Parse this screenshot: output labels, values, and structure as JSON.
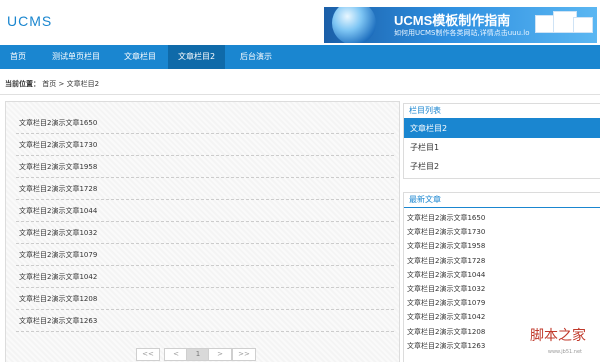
{
  "header": {
    "logo": "UCMS",
    "banner_title": "UCMS模板制作指南",
    "banner_subtitle": "如何用UCMS制作各类网站,详情点击uuu.lo"
  },
  "nav": {
    "items": [
      {
        "label": "首页"
      },
      {
        "label": "测试单页栏目"
      },
      {
        "label": "文章栏目"
      },
      {
        "label": "文章栏目2"
      },
      {
        "label": "后台演示"
      }
    ],
    "active_index": 3
  },
  "breadcrumb": {
    "prefix": "当前位置：",
    "home": "首页",
    "separator": ">",
    "current": "文章栏目2"
  },
  "articles": [
    "文章栏目2演示文章1650",
    "文章栏目2演示文章1730",
    "文章栏目2演示文章1958",
    "文章栏目2演示文章1728",
    "文章栏目2演示文章1044",
    "文章栏目2演示文章1032",
    "文章栏目2演示文章1079",
    "文章栏目2演示文章1042",
    "文章栏目2演示文章1208",
    "文章栏目2演示文章1263"
  ],
  "pager": {
    "first": "<<",
    "prev": "<",
    "current": "1",
    "next": ">",
    "last": ">>"
  },
  "category_box": {
    "title": "栏目列表",
    "items": [
      "文章栏目2",
      "子栏目1",
      "子栏目2"
    ],
    "active_index": 0
  },
  "latest_box": {
    "title": "最新文章",
    "items": [
      "文章栏目2演示文章1650",
      "文章栏目2演示文章1730",
      "文章栏目2演示文章1958",
      "文章栏目2演示文章1728",
      "文章栏目2演示文章1044",
      "文章栏目2演示文章1032",
      "文章栏目2演示文章1079",
      "文章栏目2演示文章1042",
      "文章栏目2演示文章1208",
      "文章栏目2演示文章1263"
    ]
  },
  "watermark": {
    "text": "脚本之家",
    "sub": "www.jb51.net"
  },
  "colors": {
    "accent": "#1a86d0",
    "nav_active": "#0f6aa9"
  }
}
